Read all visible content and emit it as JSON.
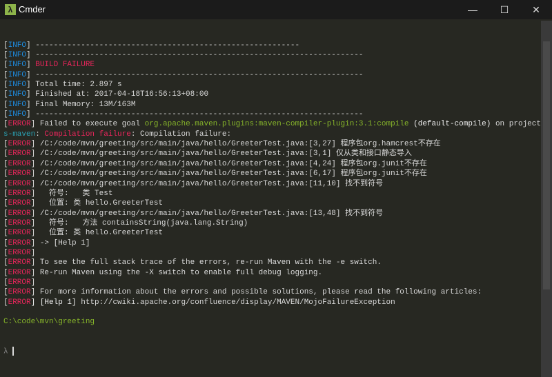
{
  "window": {
    "title": "Cmder",
    "app_icon": "λ",
    "minimize": "—",
    "maximize": "☐",
    "close": "✕"
  },
  "lines": [
    [
      [
        "[",
        "d"
      ],
      [
        "INFO",
        "b"
      ],
      [
        "] ----------------------------------------------------------",
        "d"
      ]
    ],
    [
      [
        "[",
        "d"
      ],
      [
        "INFO",
        "b"
      ],
      [
        "] ------------------------------------------------------------------------",
        "d"
      ]
    ],
    [
      [
        "[",
        "d"
      ],
      [
        "INFO",
        "b"
      ],
      [
        "] ",
        "d"
      ],
      [
        "BUILD FAILURE",
        "r"
      ]
    ],
    [
      [
        "[",
        "d"
      ],
      [
        "INFO",
        "b"
      ],
      [
        "] ------------------------------------------------------------------------",
        "d"
      ]
    ],
    [
      [
        "[",
        "d"
      ],
      [
        "INFO",
        "b"
      ],
      [
        "] Total time: 2.897 s",
        "d"
      ]
    ],
    [
      [
        "[",
        "d"
      ],
      [
        "INFO",
        "b"
      ],
      [
        "] Finished at: 2017-04-18T16:56:13+08:00",
        "d"
      ]
    ],
    [
      [
        "[",
        "d"
      ],
      [
        "INFO",
        "b"
      ],
      [
        "] Final Memory: 13M/163M",
        "d"
      ]
    ],
    [
      [
        "[",
        "d"
      ],
      [
        "INFO",
        "b"
      ],
      [
        "] ------------------------------------------------------------------------",
        "d"
      ]
    ],
    [
      [
        "[",
        "d"
      ],
      [
        "ERROR",
        "r"
      ],
      [
        "] Failed to execute goal ",
        "d"
      ],
      [
        "org.apache.maven.plugins:maven-compiler-plugin:3.1:compile",
        "g"
      ],
      [
        " (default-compile)",
        "w"
      ],
      [
        " on project",
        "d"
      ]
    ],
    [
      [
        "s-maven",
        "c"
      ],
      [
        ": ",
        "d"
      ],
      [
        "Compilation failure",
        "r"
      ],
      [
        ": Compilation failure:",
        "d"
      ]
    ],
    [
      [
        "[",
        "d"
      ],
      [
        "ERROR",
        "r"
      ],
      [
        "] /C:/code/mvn/greeting/src/main/java/hello/GreeterTest.java:[3,27] 程序包org.hamcrest不存在",
        "d"
      ]
    ],
    [
      [
        "[",
        "d"
      ],
      [
        "ERROR",
        "r"
      ],
      [
        "] /C:/code/mvn/greeting/src/main/java/hello/GreeterTest.java:[3,1] 仅从类和接口静态导入",
        "d"
      ]
    ],
    [
      [
        "[",
        "d"
      ],
      [
        "ERROR",
        "r"
      ],
      [
        "] /C:/code/mvn/greeting/src/main/java/hello/GreeterTest.java:[4,24] 程序包org.junit不存在",
        "d"
      ]
    ],
    [
      [
        "[",
        "d"
      ],
      [
        "ERROR",
        "r"
      ],
      [
        "] /C:/code/mvn/greeting/src/main/java/hello/GreeterTest.java:[6,17] 程序包org.junit不存在",
        "d"
      ]
    ],
    [
      [
        "[",
        "d"
      ],
      [
        "ERROR",
        "r"
      ],
      [
        "] /C:/code/mvn/greeting/src/main/java/hello/GreeterTest.java:[11,10] 找不到符号",
        "d"
      ]
    ],
    [
      [
        "[",
        "d"
      ],
      [
        "ERROR",
        "r"
      ],
      [
        "]   符号:   类 Test",
        "d"
      ]
    ],
    [
      [
        "[",
        "d"
      ],
      [
        "ERROR",
        "r"
      ],
      [
        "]   位置: 类 hello.GreeterTest",
        "d"
      ]
    ],
    [
      [
        "[",
        "d"
      ],
      [
        "ERROR",
        "r"
      ],
      [
        "] /C:/code/mvn/greeting/src/main/java/hello/GreeterTest.java:[13,48] 找不到符号",
        "d"
      ]
    ],
    [
      [
        "[",
        "d"
      ],
      [
        "ERROR",
        "r"
      ],
      [
        "]   符号:   方法 containsString(java.lang.String)",
        "d"
      ]
    ],
    [
      [
        "[",
        "d"
      ],
      [
        "ERROR",
        "r"
      ],
      [
        "]   位置: 类 hello.GreeterTest",
        "d"
      ]
    ],
    [
      [
        "[",
        "d"
      ],
      [
        "ERROR",
        "r"
      ],
      [
        "] -> [Help 1]",
        "d"
      ]
    ],
    [
      [
        "[",
        "d"
      ],
      [
        "ERROR",
        "r"
      ],
      [
        "]",
        "d"
      ]
    ],
    [
      [
        "[",
        "d"
      ],
      [
        "ERROR",
        "r"
      ],
      [
        "] To see the full stack trace of the errors, re-run Maven with the -e switch.",
        "d"
      ]
    ],
    [
      [
        "[",
        "d"
      ],
      [
        "ERROR",
        "r"
      ],
      [
        "] Re-run Maven using the -X switch to enable full debug logging.",
        "d"
      ]
    ],
    [
      [
        "[",
        "d"
      ],
      [
        "ERROR",
        "r"
      ],
      [
        "]",
        "d"
      ]
    ],
    [
      [
        "[",
        "d"
      ],
      [
        "ERROR",
        "r"
      ],
      [
        "] For more information about the errors and possible solutions, please read the following articles:",
        "d"
      ]
    ],
    [
      [
        "[",
        "d"
      ],
      [
        "ERROR",
        "r"
      ],
      [
        "] [Help 1]",
        "w"
      ],
      [
        " http://cwiki.apache.org/confluence/display/MAVEN/MojoFailureException",
        "d"
      ]
    ],
    [
      [
        "",
        "d"
      ]
    ],
    [
      [
        "C:\\code\\mvn\\greeting",
        "g"
      ]
    ]
  ],
  "prompt": {
    "symbol": "λ",
    "input": ""
  }
}
